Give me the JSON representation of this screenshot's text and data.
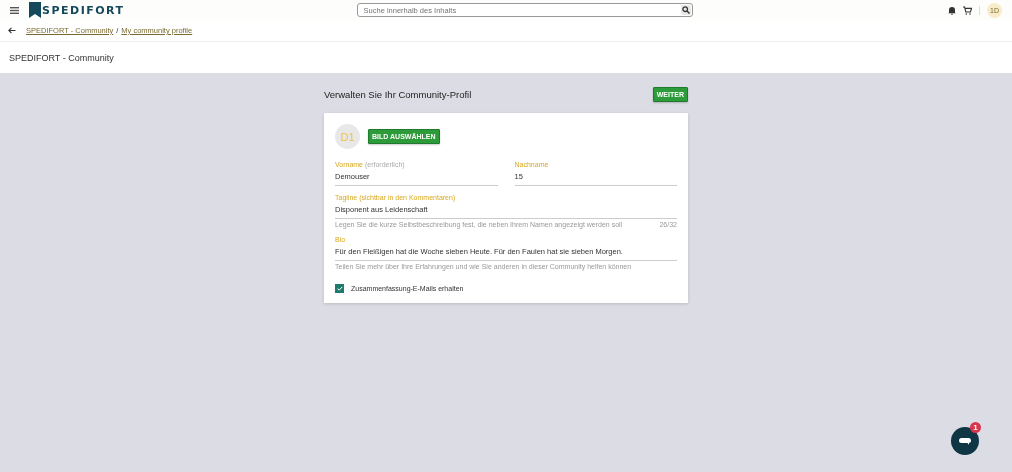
{
  "header": {
    "logo": "SPEDIFORT",
    "search": {
      "placeholder": "Suche innerhalb des Inhalts"
    },
    "avatar": "1D"
  },
  "breadcrumb": [
    {
      "label": "SPEDIFORT - Community"
    },
    {
      "label": "My community profile"
    }
  ],
  "breadcrumb_separator": "/",
  "page_title": "SPEDIFORT - Community",
  "form": {
    "heading": "Verwalten Sie Ihr Community-Profil",
    "next_button": "WEITER",
    "avatar": "D1",
    "choose_image_button": "BILD AUSWÄHLEN",
    "first_name": {
      "label": "Vorname",
      "note": "(erforderlich)",
      "value": "Demouser"
    },
    "last_name": {
      "label": "Nachname",
      "value": "15"
    },
    "tagline": {
      "label": "Tagline (sichtbar in den Kommentaren)",
      "value": "Disponent aus Leidenschaft",
      "hint": "Legen Sie die kurze Selbstbeschreibung fest, die neben Ihrem Namen angezeigt werden soll",
      "counter": "26/32"
    },
    "bio": {
      "label": "Bio",
      "value": "Für den Fleißigen hat die Woche sieben Heute. Für den Faulen hat sie sieben Morgen.",
      "hint": "Teilen Sie mehr über Ihre Erfahrungen und wie Sie anderen in dieser Community helfen können"
    },
    "digest": {
      "label": "Zusammenfassung-E-Mails erhalten",
      "checked": true
    }
  },
  "chat": {
    "badge": "1"
  }
}
